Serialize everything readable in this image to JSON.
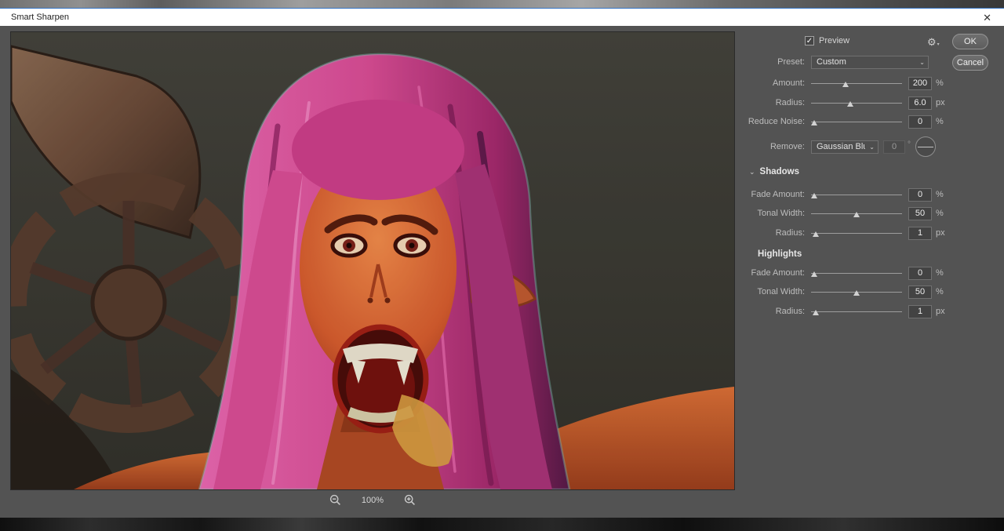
{
  "colors": {
    "dialog_bg": "#535353",
    "titlebar_bg": "#ffffff",
    "titlebar_accent": "#3574c4",
    "field_bg": "#434343",
    "label_text": "#bdbdbd",
    "hair_pink": "#d94d95",
    "skin_orange": "#d55c2e"
  },
  "window": {
    "title": "Smart Sharpen",
    "close_symbol": "✕"
  },
  "actions": {
    "preview_label": "Preview",
    "check_glyph": "✓",
    "gear_glyph": "⚙",
    "gear_caret": "▾",
    "ok_label": "OK",
    "cancel_label": "Cancel"
  },
  "preset": {
    "label": "Preset:",
    "value": "Custom",
    "chevron": "⌄"
  },
  "main_sliders": [
    {
      "label": "Amount:",
      "value": "200",
      "unit": "%"
    },
    {
      "label": "Radius:",
      "value": "6.0",
      "unit": "px"
    },
    {
      "label": "Reduce Noise:",
      "value": "0",
      "unit": "%"
    }
  ],
  "remove": {
    "label": "Remove:",
    "value": "Gaussian Blur",
    "chevron": "⌄",
    "angle_value": "0",
    "degree": "°"
  },
  "shadows": {
    "chevron": "⌄",
    "title": "Shadows",
    "sliders": [
      {
        "label": "Fade Amount:",
        "value": "0",
        "unit": "%"
      },
      {
        "label": "Tonal Width:",
        "value": "50",
        "unit": "%"
      },
      {
        "label": "Radius:",
        "value": "1",
        "unit": "px"
      }
    ]
  },
  "highlights": {
    "title": "Highlights",
    "sliders": [
      {
        "label": "Fade Amount:",
        "value": "0",
        "unit": "%"
      },
      {
        "label": "Tonal Width:",
        "value": "50",
        "unit": "%"
      },
      {
        "label": "Radius:",
        "value": "1",
        "unit": "px"
      }
    ]
  },
  "zoom": {
    "level": "100%"
  }
}
